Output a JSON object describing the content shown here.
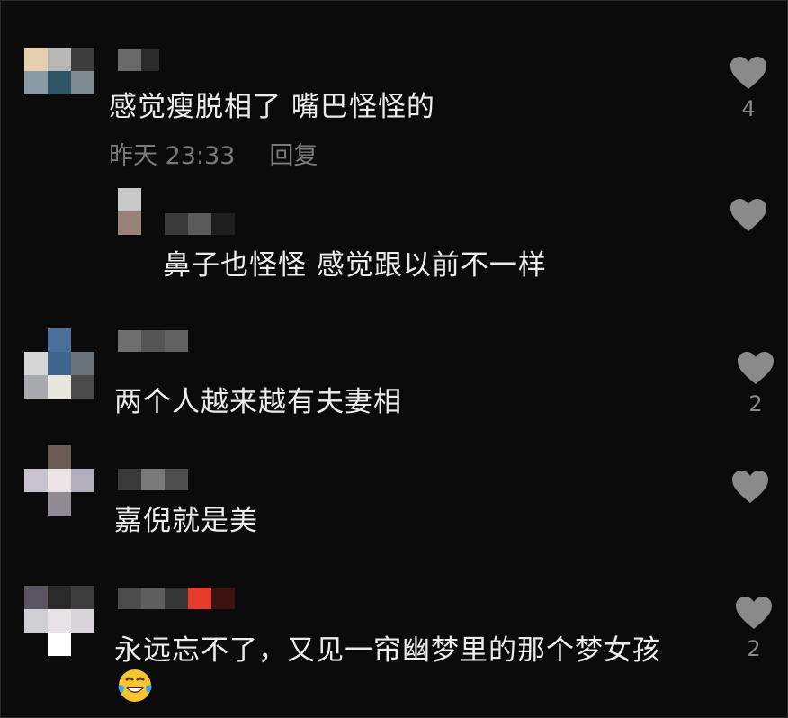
{
  "colors": {
    "background": "#0b0b0b",
    "text": "#ececec",
    "meta": "#7a7a7a",
    "heart": "#8a8a8a"
  },
  "comments": [
    {
      "text": "感觉瘦脱相了 嘴巴怪怪的",
      "time": "昨天 23:33",
      "reply_label": "回复",
      "likes": "4"
    },
    {
      "text": "鼻子也怪怪 感觉跟以前不一样",
      "likes": ""
    },
    {
      "text": "两个人越来越有夫妻相",
      "likes": "2"
    },
    {
      "text": "嘉倪就是美",
      "likes": ""
    },
    {
      "text": "永远忘不了，又见一帘幽梦里的那个梦女孩",
      "likes": "2",
      "emoji": "laughing-tears-emoji"
    }
  ]
}
